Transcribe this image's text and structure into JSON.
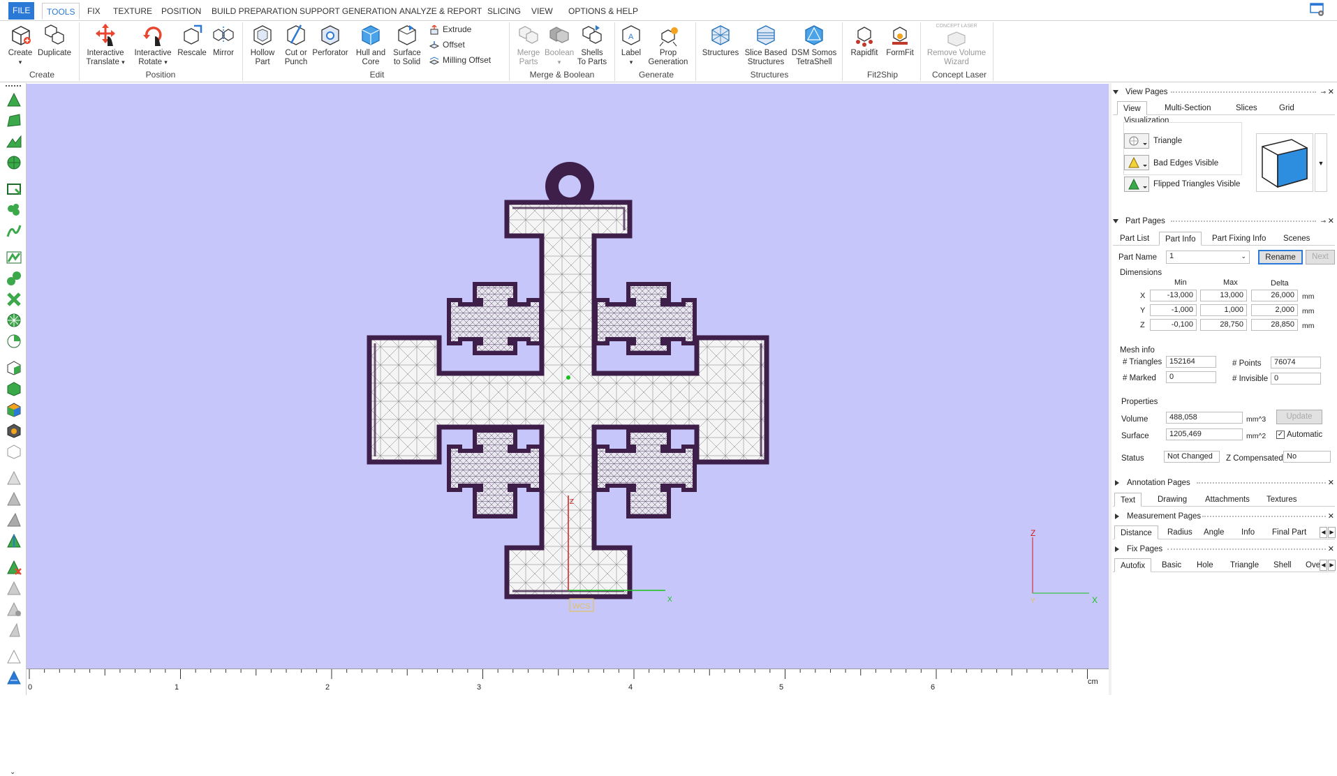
{
  "menu": {
    "tabs": [
      "FILE",
      "TOOLS",
      "FIX",
      "TEXTURE",
      "POSITION",
      "BUILD PREPARATION",
      "SUPPORT GENERATION",
      "ANALYZE & REPORT",
      "SLICING",
      "VIEW",
      "OPTIONS & HELP"
    ],
    "active": "TOOLS"
  },
  "ribbon": {
    "buttons": {
      "create": "Create",
      "duplicate": "Duplicate",
      "interactive_translate_1": "Interactive",
      "interactive_translate_2": "Translate",
      "interactive_rotate_1": "Interactive",
      "interactive_rotate_2": "Rotate",
      "rescale": "Rescale",
      "mirror": "Mirror",
      "hollow_1": "Hollow",
      "hollow_2": "Part",
      "cut_1": "Cut or",
      "cut_2": "Punch",
      "perforator": "Perforator",
      "hull_1": "Hull and",
      "hull_2": "Core",
      "surface_1": "Surface",
      "surface_2": "to Solid",
      "extrude": "Extrude",
      "offset": "Offset",
      "milling_offset": "Milling Offset",
      "merge_1": "Merge",
      "merge_2": "Parts",
      "boolean": "Boolean",
      "shells_1": "Shells",
      "shells_2": "To Parts",
      "label": "Label",
      "prop_1": "Prop",
      "prop_2": "Generation",
      "structures": "Structures",
      "slice_1": "Slice Based",
      "slice_2": "Structures",
      "dsm_1": "DSM Somos",
      "dsm_2": "TetraShell",
      "rapidfit": "Rapidfit",
      "formfit": "FormFit",
      "remove_1": "Remove Volume",
      "remove_2": "Wizard",
      "concept_logo": "CONCEPT LASER"
    },
    "groups": {
      "create": "Create",
      "position": "Position",
      "edit": "Edit",
      "merge": "Merge & Boolean",
      "generate": "Generate",
      "structures": "Structures",
      "fit2ship": "Fit2Ship",
      "concept": "Concept Laser"
    }
  },
  "viewport": {
    "axis_z": "Z",
    "axis_x": "X",
    "axis_y": "Y",
    "wcs": "WCS",
    "bg_color": "#c6c6fb"
  },
  "ruler": {
    "ticks": [
      "0",
      "1",
      "2",
      "3",
      "4",
      "5",
      "6"
    ],
    "unit": "cm"
  },
  "panel": {
    "view_pages": {
      "title": "View Pages",
      "tabs": [
        "View",
        "Multi-Section",
        "Slices",
        "Grid"
      ],
      "visualization": "Visualization",
      "items": [
        "Triangle",
        "Bad Edges Visible",
        "Flipped Triangles Visible"
      ]
    },
    "part_pages": {
      "title": "Part Pages",
      "tabs": [
        "Part List",
        "Part Info",
        "Part Fixing Info",
        "Scenes"
      ],
      "part_name_label": "Part Name",
      "part_name_value": "1",
      "rename": "Rename",
      "next": "Next",
      "dimensions": "Dimensions",
      "col_min": "Min",
      "col_max": "Max",
      "col_delta": "Delta",
      "rows": [
        {
          "axis": "X",
          "min": "-13,000",
          "max": "13,000",
          "delta": "26,000",
          "unit": "mm"
        },
        {
          "axis": "Y",
          "min": "-1,000",
          "max": "1,000",
          "delta": "2,000",
          "unit": "mm"
        },
        {
          "axis": "Z",
          "min": "-0,100",
          "max": "28,750",
          "delta": "28,850",
          "unit": "mm"
        }
      ],
      "mesh_info": "Mesh info",
      "triangles_label": "# Triangles",
      "triangles": "152164",
      "points_label": "# Points",
      "points": "76074",
      "marked_label": "# Marked",
      "marked": "0",
      "invisible_label": "# Invisible",
      "invisible": "0",
      "properties": "Properties",
      "volume_label": "Volume",
      "volume": "488,058",
      "volume_unit": "mm^3",
      "update": "Update",
      "surface_label": "Surface",
      "surface": "1205,469",
      "surface_unit": "mm^2",
      "automatic": "Automatic",
      "status_label": "Status",
      "status": "Not Changed",
      "zcomp_label": "Z Compensated",
      "zcomp": "No"
    },
    "annotation_pages": {
      "title": "Annotation Pages",
      "tabs": [
        "Text",
        "Drawing",
        "Attachments",
        "Textures"
      ]
    },
    "measurement_pages": {
      "title": "Measurement Pages",
      "tabs": [
        "Distance",
        "Radius",
        "Angle",
        "Info",
        "Final Part"
      ]
    },
    "fix_pages": {
      "title": "Fix Pages",
      "tabs": [
        "Autofix",
        "Basic",
        "Hole",
        "Triangle",
        "Shell",
        "Over"
      ]
    }
  }
}
